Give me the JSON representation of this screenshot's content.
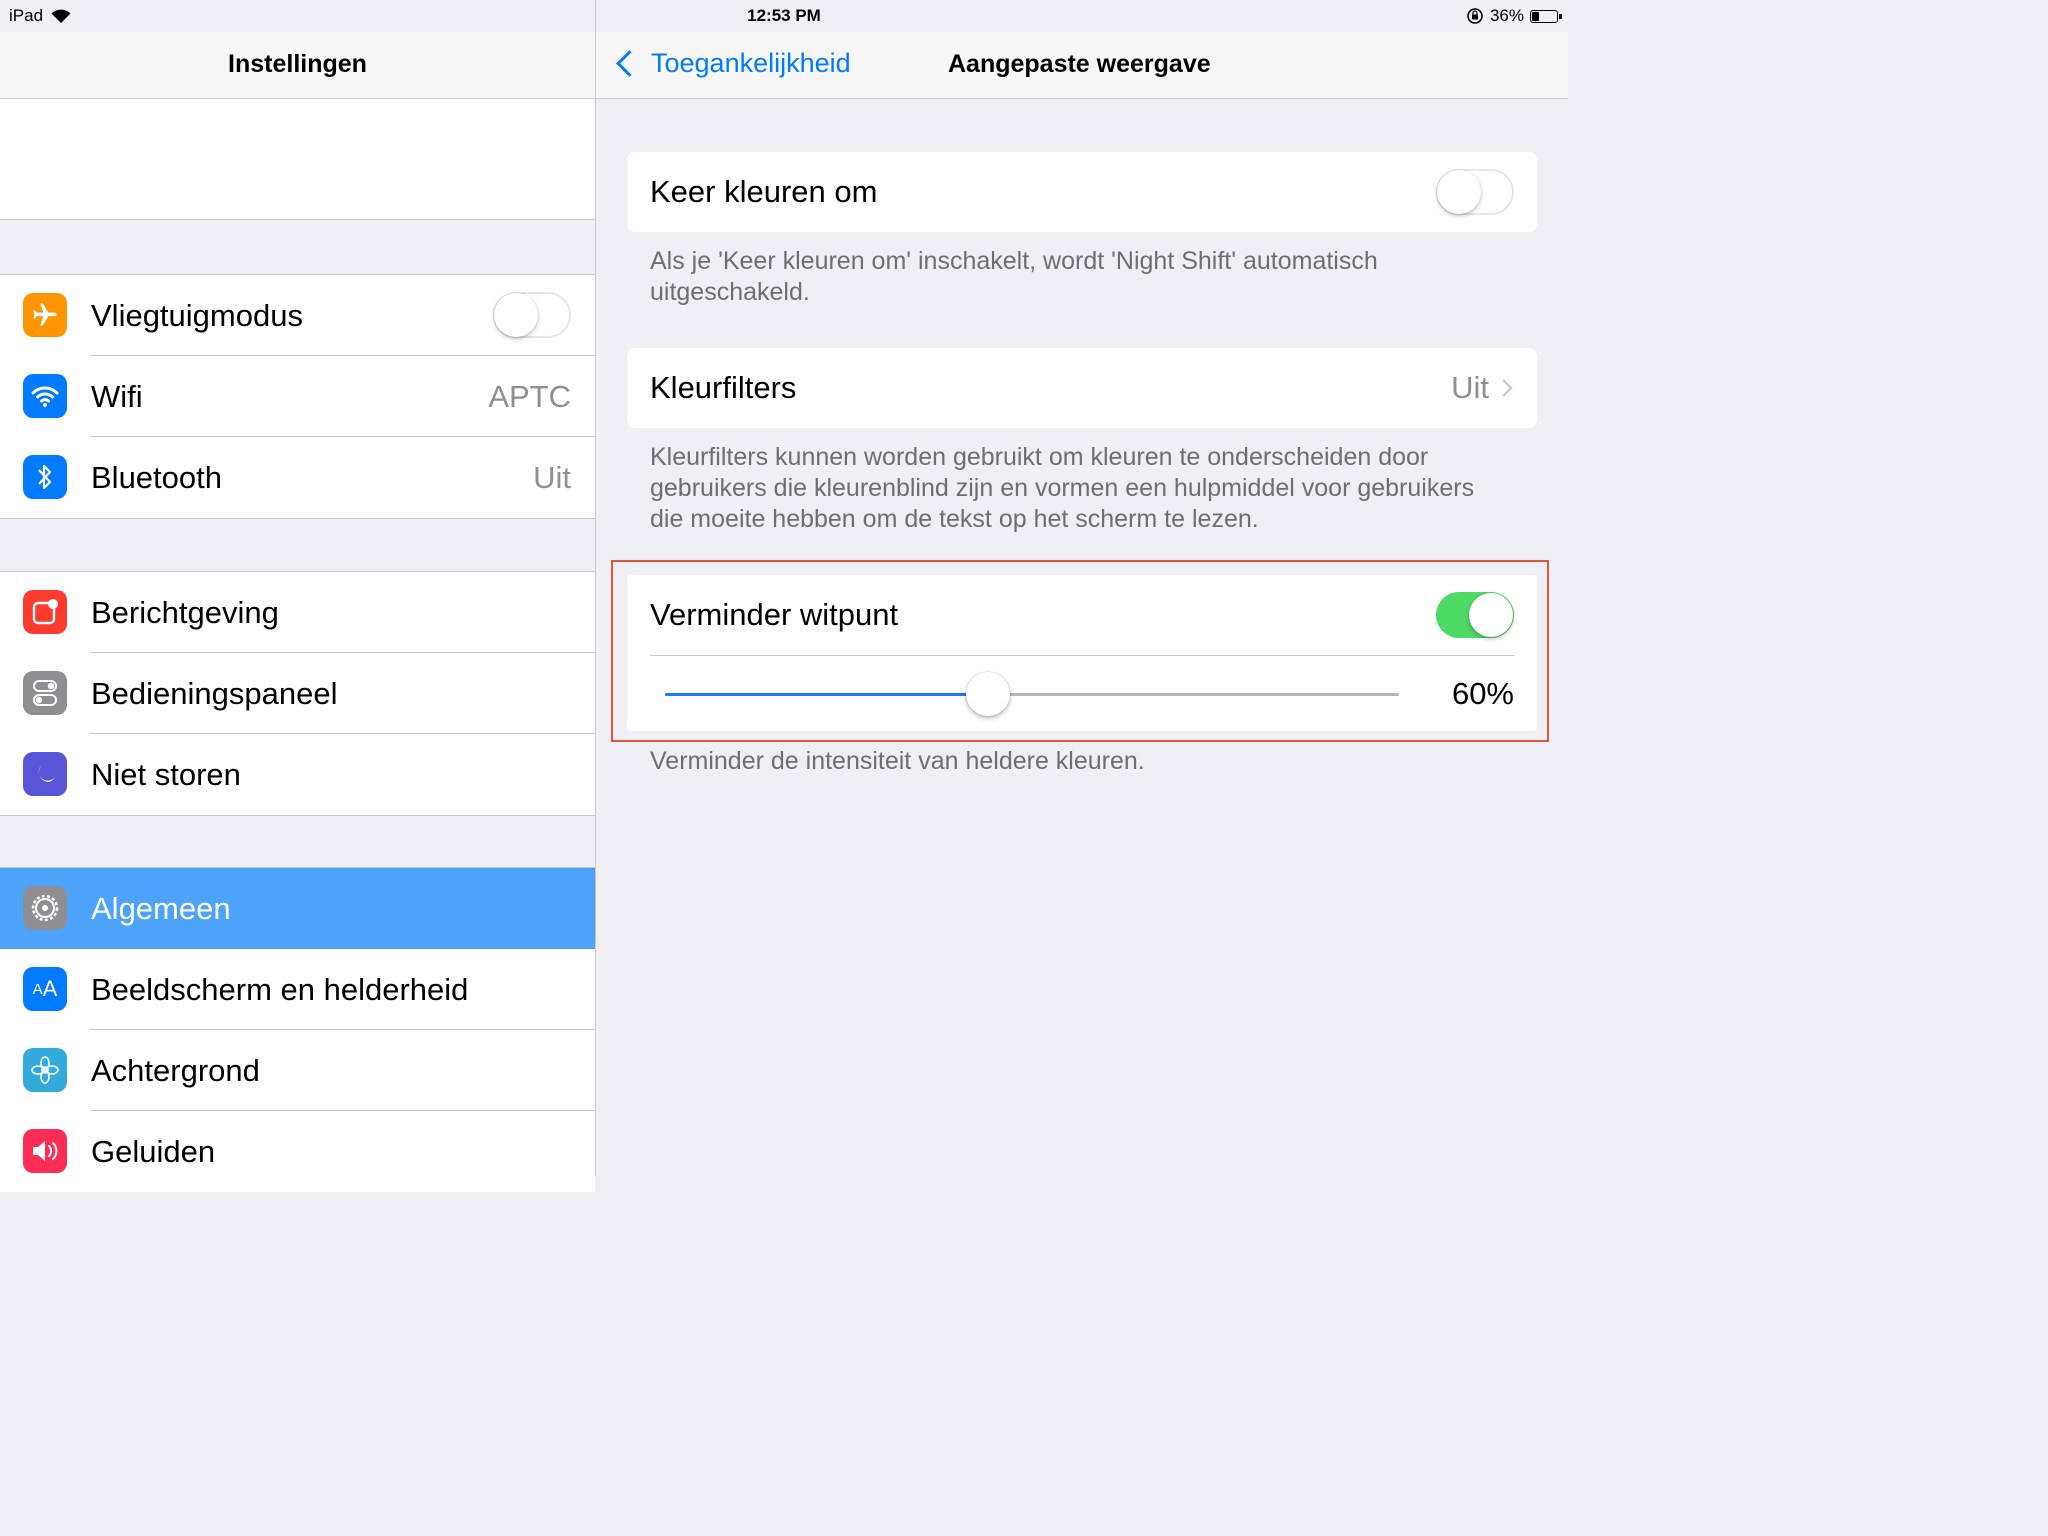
{
  "status_bar": {
    "device": "iPad",
    "time": "12:53 PM",
    "battery_percent": "36%",
    "battery_level": 0.36
  },
  "left": {
    "title": "Instellingen",
    "group1": [
      {
        "label": "Vliegtuigmodus",
        "icon": "airplane-icon",
        "color": "#ff9500",
        "toggle": false
      },
      {
        "label": "Wifi",
        "icon": "wifi-icon",
        "color": "#007aff",
        "value": "APTC"
      },
      {
        "label": "Bluetooth",
        "icon": "bluetooth-icon",
        "color": "#007aff",
        "value": "Uit"
      }
    ],
    "group2": [
      {
        "label": "Berichtgeving",
        "icon": "notifications-icon",
        "color": "#ff3b30"
      },
      {
        "label": "Bedieningspaneel",
        "icon": "control-center-icon",
        "color": "#8e8e93"
      },
      {
        "label": "Niet storen",
        "icon": "moon-icon",
        "color": "#5856d6"
      }
    ],
    "group3": [
      {
        "label": "Algemeen",
        "icon": "gear-icon",
        "color": "#8e8e93",
        "selected": true
      },
      {
        "label": "Beeldscherm en helderheid",
        "icon": "display-brightness-icon",
        "color": "#007aff"
      },
      {
        "label": "Achtergrond",
        "icon": "wallpaper-flower-icon",
        "color": "#34aadc"
      },
      {
        "label": "Geluiden",
        "icon": "speaker-icon",
        "color": "#ff2d55"
      }
    ]
  },
  "right": {
    "back_label": "Toegankelijkheid",
    "title": "Aangepaste weergave",
    "invert": {
      "label": "Keer kleuren om",
      "toggle": false,
      "footer": "Als je 'Keer kleuren om' inschakelt, wordt 'Night Shift' automatisch uitgeschakeld."
    },
    "filters": {
      "label": "Kleurfilters",
      "value": "Uit",
      "footer": "Kleurfilters kunnen worden gebruikt om kleuren te onderscheiden door gebruikers die kleurenblind zijn en vormen een hulpmiddel voor gebruikers die moeite hebben om de tekst op het scherm te lezen."
    },
    "whitepoint": {
      "label": "Verminder witpunt",
      "toggle": true,
      "percent": "60%",
      "slider_value": 0.44,
      "footer": "Verminder de intensiteit van heldere kleuren."
    }
  }
}
